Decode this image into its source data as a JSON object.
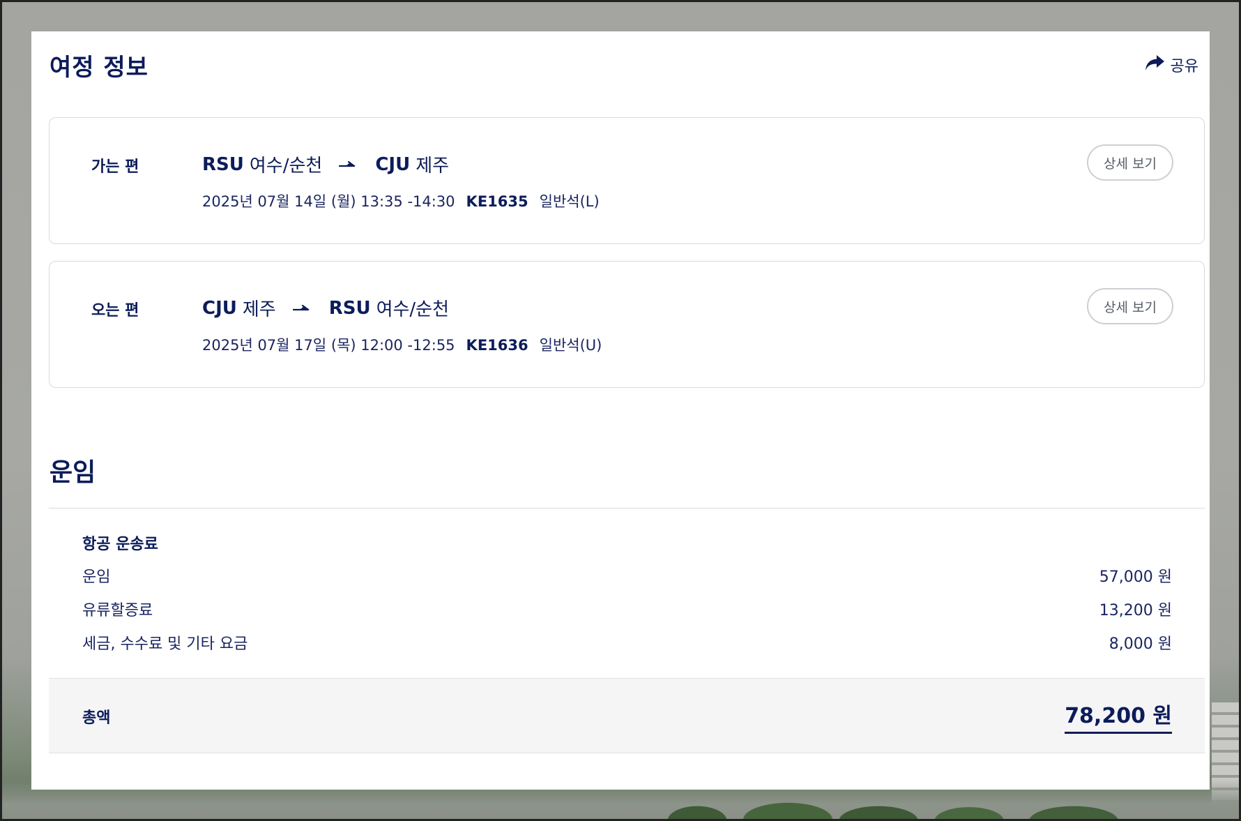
{
  "colors": {
    "primary_navy": "#0c1c5a",
    "border": "#d9d9de",
    "total_bg": "#f5f5f6"
  },
  "header": {
    "title": "여정 정보",
    "share_label": "공유",
    "share_icon": "share-arrow-icon"
  },
  "segments": [
    {
      "label": "가는 편",
      "origin_code": "RSU",
      "origin_city": "여수/순천",
      "dest_code": "CJU",
      "dest_city": "제주",
      "datetime": "2025년 07월 14일 (월) 13:35 -14:30",
      "flight": "KE1635",
      "cabin": "일반석(L)",
      "detail_button": "상세 보기"
    },
    {
      "label": "오는 편",
      "origin_code": "CJU",
      "origin_city": "제주",
      "dest_code": "RSU",
      "dest_city": "여수/순천",
      "datetime": "2025년 07월 17일 (목) 12:00 -12:55",
      "flight": "KE1636",
      "cabin": "일반석(U)",
      "detail_button": "상세 보기"
    }
  ],
  "fare": {
    "title": "운임",
    "section_title": "항공 운송료",
    "rows": [
      {
        "label": "운임",
        "value": "57,000 원"
      },
      {
        "label": "유류할증료",
        "value": "13,200 원"
      },
      {
        "label": "세금, 수수료 및 기타 요금",
        "value": "8,000 원"
      }
    ],
    "total_label": "총액",
    "total_value": "78,200 원"
  }
}
